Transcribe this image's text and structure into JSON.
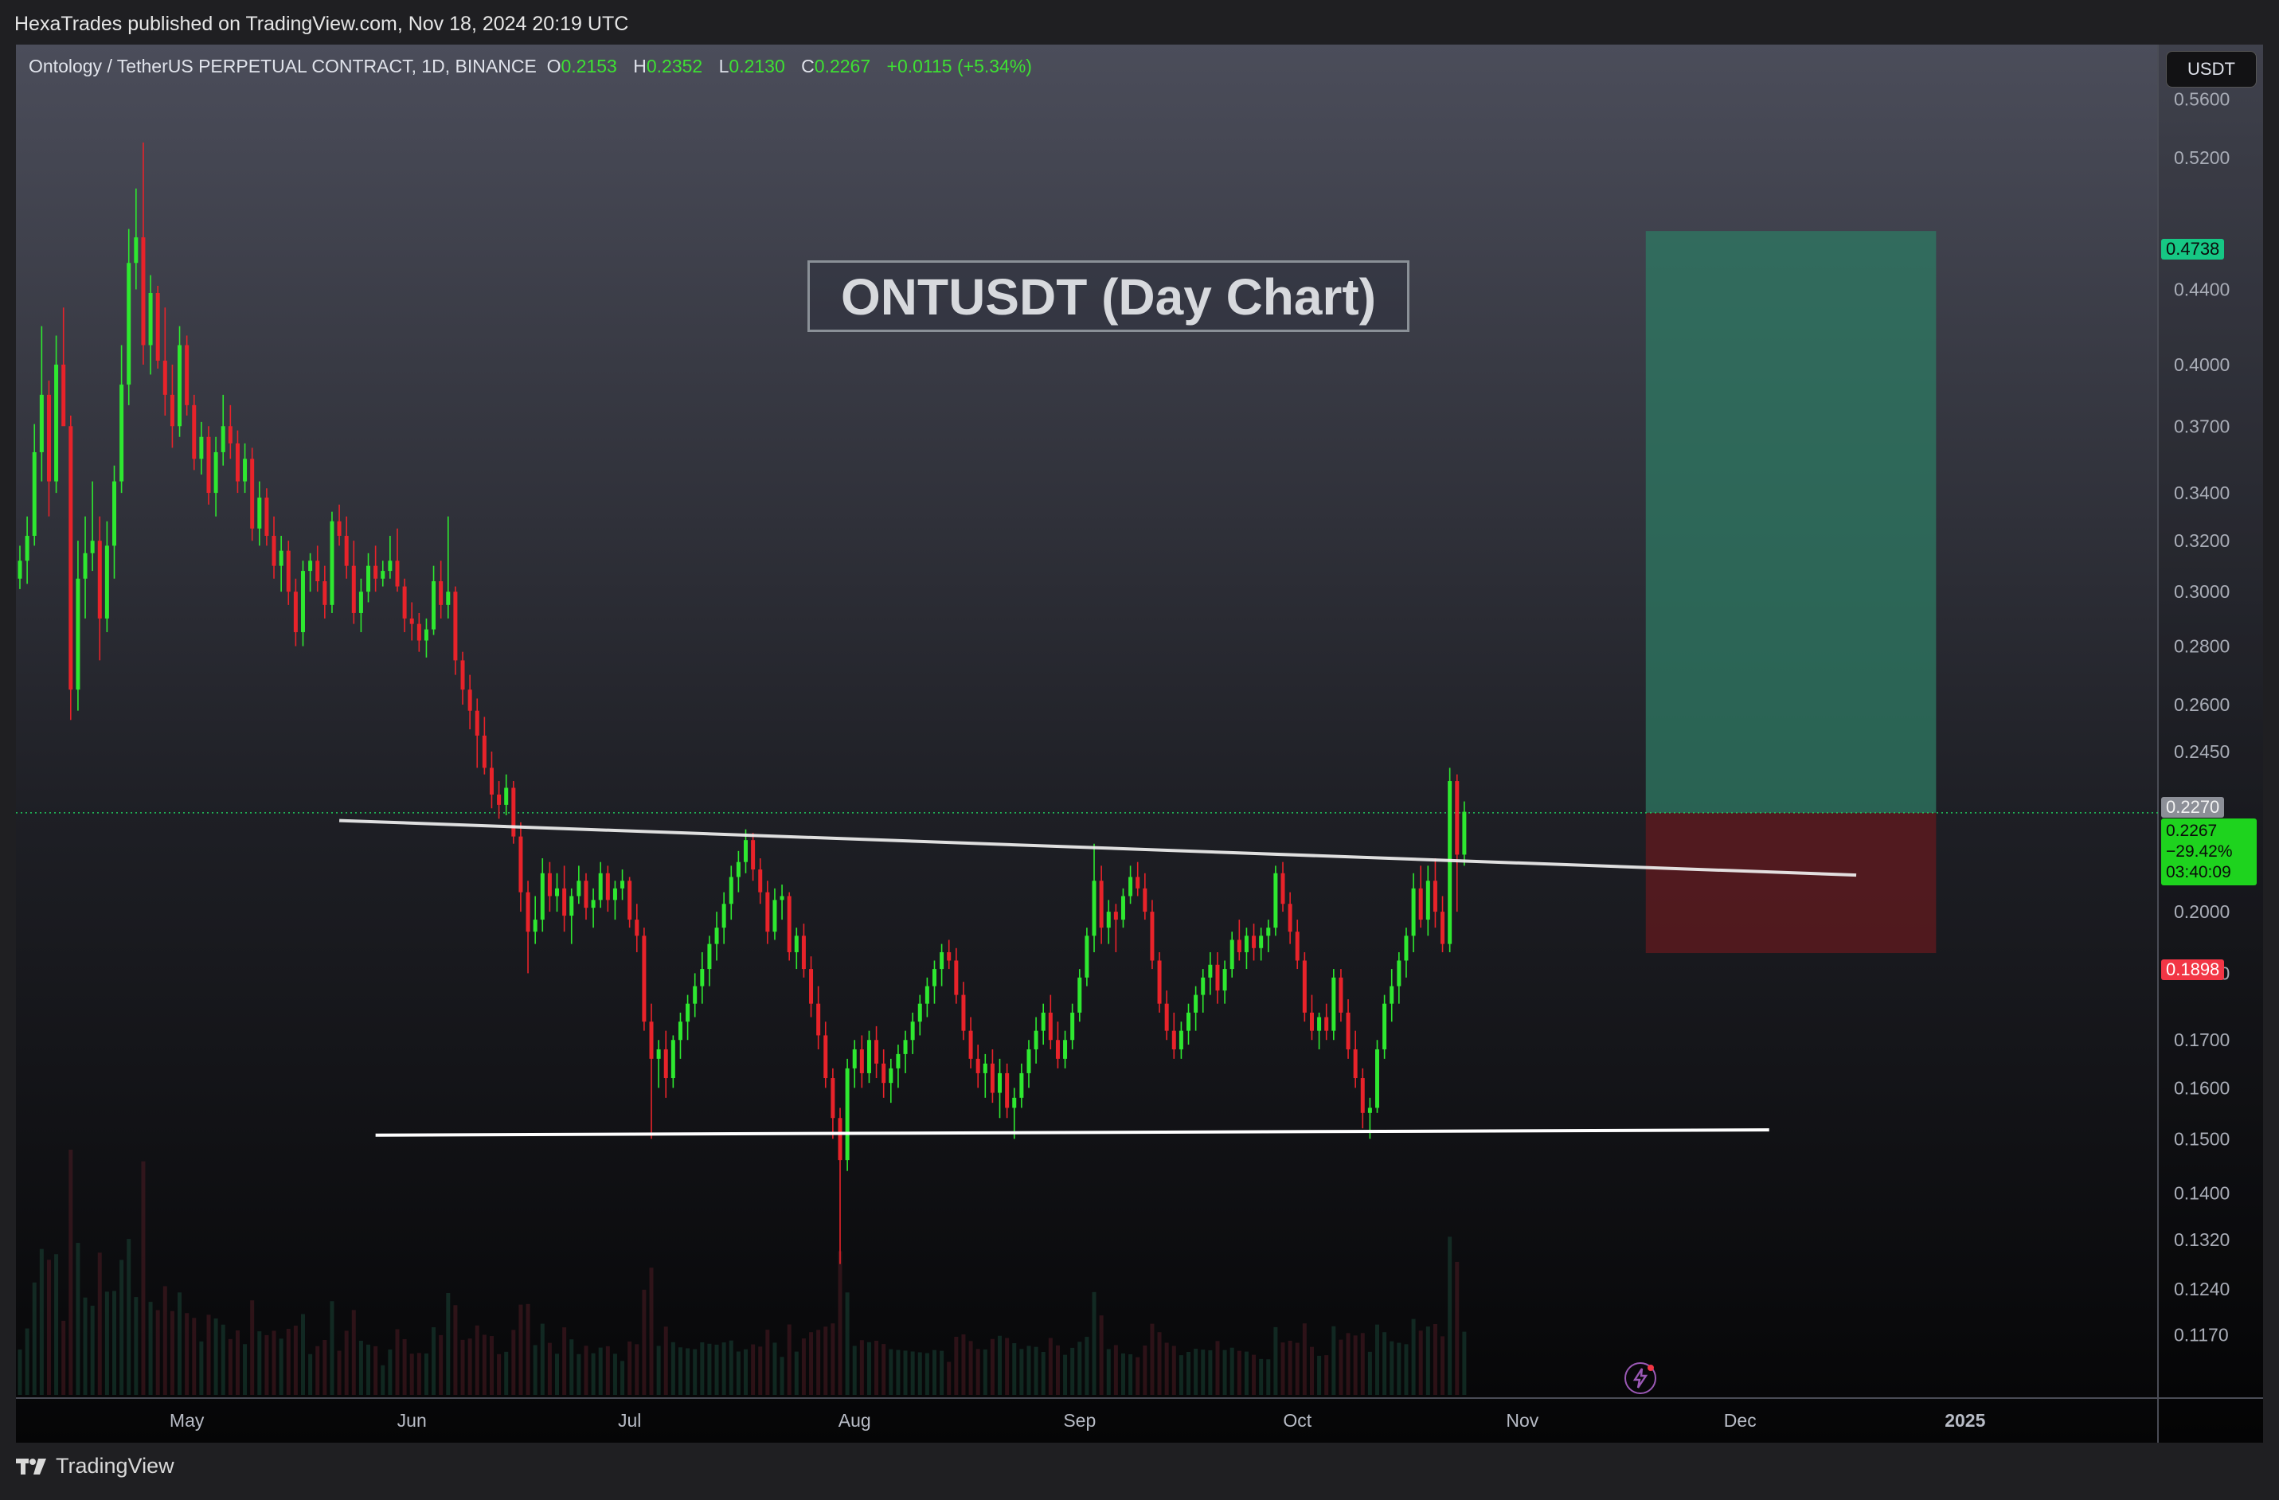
{
  "header": {
    "published": "HexaTrades published on TradingView.com, Nov 18, 2024 20:19 UTC"
  },
  "legend": {
    "symbol": "Ontology / TetherUS PERPETUAL CONTRACT, 1D, BINANCE",
    "o_label": "O",
    "o_value": "0.2153",
    "h_label": "H",
    "h_value": "0.2352",
    "l_label": "L",
    "l_value": "0.2130",
    "c_label": "C",
    "c_value": "0.2267",
    "change": "+0.0115 (+5.34%)"
  },
  "annotation_title": "ONTUSDT (Day Chart)",
  "currency_button": "USDT",
  "price_tags": {
    "target": "0.4738",
    "prev": "0.2270",
    "current": "0.2267",
    "current_pct": "−29.42%",
    "countdown": "03:40:09",
    "stop": "0.1898"
  },
  "footer": {
    "brand": "TradingView"
  },
  "colors": {
    "up": "#2ee830",
    "down": "#e8232a",
    "target_zone": "#2d7a63",
    "stop_zone": "#5a1a1e",
    "price_line": "#22c55e",
    "trendline": "#ffffff"
  },
  "chart_data": {
    "type": "candlestick",
    "title": "ONTUSDT (Day Chart)",
    "scale": "log",
    "y_ticks": [
      0.117,
      0.124,
      0.132,
      0.14,
      0.15,
      0.16,
      0.17,
      0.185,
      0.2,
      0.245,
      0.26,
      0.28,
      0.3,
      0.32,
      0.34,
      0.37,
      0.4,
      0.44,
      0.52,
      0.56
    ],
    "y_tick_labels": [
      "0.1170",
      "0.1240",
      "0.1320",
      "0.1400",
      "0.1500",
      "0.1600",
      "0.1700",
      "0.1850",
      "0.2000",
      "0.2450",
      "0.2600",
      "0.2800",
      "0.3000",
      "0.3200",
      "0.3400",
      "0.3700",
      "0.4000",
      "0.4400",
      "0.5200",
      "0.5600"
    ],
    "ylim": [
      0.108,
      0.6
    ],
    "x_ticks": [
      {
        "label": "May",
        "date": "2024-05-01"
      },
      {
        "label": "Jun",
        "date": "2024-06-01"
      },
      {
        "label": "Jul",
        "date": "2024-07-01"
      },
      {
        "label": "Aug",
        "date": "2024-08-01"
      },
      {
        "label": "Sep",
        "date": "2024-09-01"
      },
      {
        "label": "Oct",
        "date": "2024-10-01"
      },
      {
        "label": "Nov",
        "date": "2024-11-01"
      },
      {
        "label": "Dec",
        "date": "2024-12-01"
      },
      {
        "label": "2025",
        "date": "2025-01-01"
      }
    ],
    "last_close": 0.2267,
    "target_price": 0.4738,
    "entry_price": 0.2267,
    "stop_price": 0.1898,
    "position_start": "2024-11-18",
    "position_end": "2024-12-28",
    "resistance_line": {
      "start_date": "2024-05-22",
      "start_price": 0.2245,
      "end_date": "2024-12-17",
      "end_price": 0.2095
    },
    "support_line": {
      "start_date": "2024-05-27",
      "start_price": 0.1507,
      "end_date": "2024-12-05",
      "end_price": 0.1517
    },
    "candles_ohlc_from_2024-04-08": [
      [
        0.305,
        0.318,
        0.301,
        0.312
      ],
      [
        0.312,
        0.33,
        0.303,
        0.322
      ],
      [
        0.322,
        0.371,
        0.318,
        0.358
      ],
      [
        0.358,
        0.42,
        0.345,
        0.385
      ],
      [
        0.385,
        0.392,
        0.33,
        0.345
      ],
      [
        0.345,
        0.415,
        0.34,
        0.4
      ],
      [
        0.4,
        0.43,
        0.395,
        0.37
      ],
      [
        0.37,
        0.375,
        0.255,
        0.265
      ],
      [
        0.265,
        0.32,
        0.258,
        0.305
      ],
      [
        0.305,
        0.33,
        0.29,
        0.315
      ],
      [
        0.315,
        0.345,
        0.308,
        0.32
      ],
      [
        0.32,
        0.33,
        0.275,
        0.29
      ],
      [
        0.29,
        0.328,
        0.285,
        0.318
      ],
      [
        0.318,
        0.352,
        0.305,
        0.345
      ],
      [
        0.345,
        0.41,
        0.34,
        0.39
      ],
      [
        0.39,
        0.475,
        0.38,
        0.455
      ],
      [
        0.455,
        0.5,
        0.44,
        0.47
      ],
      [
        0.47,
        0.53,
        0.4,
        0.41
      ],
      [
        0.41,
        0.448,
        0.395,
        0.438
      ],
      [
        0.438,
        0.442,
        0.398,
        0.402
      ],
      [
        0.402,
        0.43,
        0.375,
        0.385
      ],
      [
        0.385,
        0.4,
        0.36,
        0.37
      ],
      [
        0.37,
        0.42,
        0.365,
        0.41
      ],
      [
        0.41,
        0.415,
        0.375,
        0.38
      ],
      [
        0.38,
        0.385,
        0.35,
        0.355
      ],
      [
        0.355,
        0.372,
        0.348,
        0.365
      ],
      [
        0.365,
        0.37,
        0.335,
        0.34
      ],
      [
        0.34,
        0.365,
        0.33,
        0.358
      ],
      [
        0.358,
        0.385,
        0.352,
        0.37
      ],
      [
        0.37,
        0.38,
        0.355,
        0.362
      ],
      [
        0.362,
        0.368,
        0.34,
        0.345
      ],
      [
        0.345,
        0.362,
        0.34,
        0.355
      ],
      [
        0.355,
        0.36,
        0.32,
        0.325
      ],
      [
        0.325,
        0.345,
        0.318,
        0.338
      ],
      [
        0.338,
        0.342,
        0.318,
        0.322
      ],
      [
        0.322,
        0.33,
        0.305,
        0.31
      ],
      [
        0.31,
        0.322,
        0.3,
        0.316
      ],
      [
        0.316,
        0.32,
        0.295,
        0.3
      ],
      [
        0.3,
        0.305,
        0.28,
        0.285
      ],
      [
        0.285,
        0.312,
        0.28,
        0.308
      ],
      [
        0.308,
        0.315,
        0.3,
        0.312
      ],
      [
        0.312,
        0.318,
        0.3,
        0.304
      ],
      [
        0.304,
        0.31,
        0.29,
        0.295
      ],
      [
        0.295,
        0.332,
        0.292,
        0.328
      ],
      [
        0.328,
        0.335,
        0.318,
        0.322
      ],
      [
        0.322,
        0.33,
        0.305,
        0.31
      ],
      [
        0.31,
        0.32,
        0.288,
        0.292
      ],
      [
        0.292,
        0.305,
        0.285,
        0.3
      ],
      [
        0.3,
        0.315,
        0.296,
        0.31
      ],
      [
        0.31,
        0.318,
        0.3,
        0.305
      ],
      [
        0.305,
        0.312,
        0.302,
        0.308
      ],
      [
        0.308,
        0.322,
        0.305,
        0.312
      ],
      [
        0.312,
        0.325,
        0.3,
        0.302
      ],
      [
        0.302,
        0.305,
        0.285,
        0.29
      ],
      [
        0.29,
        0.296,
        0.282,
        0.288
      ],
      [
        0.288,
        0.292,
        0.278,
        0.282
      ],
      [
        0.282,
        0.29,
        0.276,
        0.286
      ],
      [
        0.286,
        0.31,
        0.284,
        0.304
      ],
      [
        0.304,
        0.312,
        0.29,
        0.295
      ],
      [
        0.295,
        0.33,
        0.29,
        0.3
      ],
      [
        0.3,
        0.302,
        0.27,
        0.275
      ],
      [
        0.275,
        0.278,
        0.26,
        0.265
      ],
      [
        0.265,
        0.27,
        0.252,
        0.258
      ],
      [
        0.258,
        0.262,
        0.24,
        0.25
      ],
      [
        0.25,
        0.256,
        0.238,
        0.24
      ],
      [
        0.24,
        0.245,
        0.228,
        0.232
      ],
      [
        0.232,
        0.236,
        0.225,
        0.229
      ],
      [
        0.229,
        0.238,
        0.226,
        0.234
      ],
      [
        0.234,
        0.236,
        0.218,
        0.22
      ],
      [
        0.22,
        0.224,
        0.2,
        0.205
      ],
      [
        0.205,
        0.208,
        0.185,
        0.195
      ],
      [
        0.195,
        0.204,
        0.192,
        0.198
      ],
      [
        0.198,
        0.214,
        0.195,
        0.21
      ],
      [
        0.21,
        0.213,
        0.2,
        0.204
      ],
      [
        0.204,
        0.21,
        0.2,
        0.206
      ],
      [
        0.206,
        0.212,
        0.195,
        0.199
      ],
      [
        0.199,
        0.206,
        0.192,
        0.204
      ],
      [
        0.204,
        0.212,
        0.202,
        0.208
      ],
      [
        0.208,
        0.21,
        0.198,
        0.201
      ],
      [
        0.201,
        0.206,
        0.196,
        0.203
      ],
      [
        0.203,
        0.213,
        0.201,
        0.21
      ],
      [
        0.21,
        0.212,
        0.2,
        0.203
      ],
      [
        0.203,
        0.208,
        0.198,
        0.206
      ],
      [
        0.206,
        0.211,
        0.203,
        0.208
      ],
      [
        0.208,
        0.209,
        0.196,
        0.198
      ],
      [
        0.198,
        0.202,
        0.19,
        0.194
      ],
      [
        0.194,
        0.196,
        0.172,
        0.174
      ],
      [
        0.174,
        0.178,
        0.15,
        0.166
      ],
      [
        0.166,
        0.17,
        0.16,
        0.168
      ],
      [
        0.168,
        0.172,
        0.158,
        0.162
      ],
      [
        0.162,
        0.171,
        0.16,
        0.17
      ],
      [
        0.17,
        0.176,
        0.166,
        0.174
      ],
      [
        0.174,
        0.18,
        0.17,
        0.178
      ],
      [
        0.178,
        0.185,
        0.175,
        0.182
      ],
      [
        0.182,
        0.19,
        0.178,
        0.186
      ],
      [
        0.186,
        0.194,
        0.182,
        0.192
      ],
      [
        0.192,
        0.2,
        0.188,
        0.196
      ],
      [
        0.196,
        0.205,
        0.192,
        0.202
      ],
      [
        0.202,
        0.212,
        0.198,
        0.209
      ],
      [
        0.209,
        0.216,
        0.205,
        0.213
      ],
      [
        0.213,
        0.222,
        0.21,
        0.219
      ],
      [
        0.219,
        0.221,
        0.208,
        0.211
      ],
      [
        0.211,
        0.214,
        0.202,
        0.205
      ],
      [
        0.205,
        0.208,
        0.192,
        0.195
      ],
      [
        0.195,
        0.206,
        0.193,
        0.203
      ],
      [
        0.203,
        0.207,
        0.198,
        0.204
      ],
      [
        0.204,
        0.205,
        0.188,
        0.19
      ],
      [
        0.19,
        0.196,
        0.186,
        0.194
      ],
      [
        0.194,
        0.197,
        0.184,
        0.186
      ],
      [
        0.186,
        0.189,
        0.175,
        0.178
      ],
      [
        0.178,
        0.182,
        0.168,
        0.171
      ],
      [
        0.171,
        0.174,
        0.16,
        0.162
      ],
      [
        0.162,
        0.164,
        0.15,
        0.154
      ],
      [
        0.154,
        0.156,
        0.128,
        0.146
      ],
      [
        0.146,
        0.166,
        0.144,
        0.164
      ],
      [
        0.164,
        0.17,
        0.16,
        0.168
      ],
      [
        0.168,
        0.171,
        0.16,
        0.163
      ],
      [
        0.163,
        0.172,
        0.161,
        0.17
      ],
      [
        0.17,
        0.173,
        0.162,
        0.165
      ],
      [
        0.165,
        0.168,
        0.158,
        0.161
      ],
      [
        0.161,
        0.166,
        0.157,
        0.164
      ],
      [
        0.164,
        0.169,
        0.16,
        0.167
      ],
      [
        0.167,
        0.172,
        0.163,
        0.17
      ],
      [
        0.17,
        0.176,
        0.167,
        0.174
      ],
      [
        0.174,
        0.18,
        0.171,
        0.178
      ],
      [
        0.178,
        0.184,
        0.175,
        0.182
      ],
      [
        0.182,
        0.188,
        0.178,
        0.186
      ],
      [
        0.186,
        0.192,
        0.182,
        0.19
      ],
      [
        0.19,
        0.193,
        0.186,
        0.188
      ],
      [
        0.188,
        0.191,
        0.178,
        0.18
      ],
      [
        0.18,
        0.183,
        0.17,
        0.172
      ],
      [
        0.172,
        0.175,
        0.164,
        0.166
      ],
      [
        0.166,
        0.169,
        0.16,
        0.163
      ],
      [
        0.163,
        0.167,
        0.158,
        0.165
      ],
      [
        0.165,
        0.168,
        0.157,
        0.159
      ],
      [
        0.159,
        0.166,
        0.154,
        0.163
      ],
      [
        0.163,
        0.165,
        0.154,
        0.156
      ],
      [
        0.156,
        0.16,
        0.15,
        0.158
      ],
      [
        0.158,
        0.165,
        0.156,
        0.163
      ],
      [
        0.163,
        0.17,
        0.16,
        0.168
      ],
      [
        0.168,
        0.175,
        0.165,
        0.172
      ],
      [
        0.172,
        0.178,
        0.169,
        0.176
      ],
      [
        0.176,
        0.18,
        0.168,
        0.17
      ],
      [
        0.17,
        0.174,
        0.164,
        0.166
      ],
      [
        0.166,
        0.172,
        0.164,
        0.17
      ],
      [
        0.17,
        0.178,
        0.168,
        0.176
      ],
      [
        0.176,
        0.186,
        0.174,
        0.184
      ],
      [
        0.184,
        0.196,
        0.182,
        0.194
      ],
      [
        0.194,
        0.218,
        0.19,
        0.208
      ],
      [
        0.208,
        0.212,
        0.192,
        0.196
      ],
      [
        0.196,
        0.203,
        0.192,
        0.2
      ],
      [
        0.2,
        0.202,
        0.19,
        0.198
      ],
      [
        0.198,
        0.206,
        0.196,
        0.204
      ],
      [
        0.204,
        0.212,
        0.202,
        0.209
      ],
      [
        0.209,
        0.213,
        0.204,
        0.206
      ],
      [
        0.206,
        0.21,
        0.198,
        0.2
      ],
      [
        0.2,
        0.203,
        0.186,
        0.188
      ],
      [
        0.188,
        0.19,
        0.176,
        0.178
      ],
      [
        0.178,
        0.181,
        0.17,
        0.172
      ],
      [
        0.172,
        0.176,
        0.166,
        0.168
      ],
      [
        0.168,
        0.174,
        0.166,
        0.172
      ],
      [
        0.172,
        0.178,
        0.169,
        0.176
      ],
      [
        0.176,
        0.182,
        0.172,
        0.18
      ],
      [
        0.18,
        0.186,
        0.176,
        0.184
      ],
      [
        0.184,
        0.19,
        0.18,
        0.187
      ],
      [
        0.187,
        0.19,
        0.178,
        0.181
      ],
      [
        0.181,
        0.188,
        0.178,
        0.186
      ],
      [
        0.186,
        0.195,
        0.184,
        0.193
      ],
      [
        0.193,
        0.198,
        0.188,
        0.19
      ],
      [
        0.19,
        0.196,
        0.186,
        0.194
      ],
      [
        0.194,
        0.197,
        0.188,
        0.191
      ],
      [
        0.191,
        0.196,
        0.188,
        0.194
      ],
      [
        0.194,
        0.198,
        0.19,
        0.196
      ],
      [
        0.196,
        0.212,
        0.194,
        0.21
      ],
      [
        0.21,
        0.213,
        0.2,
        0.202
      ],
      [
        0.202,
        0.205,
        0.192,
        0.195
      ],
      [
        0.195,
        0.198,
        0.186,
        0.188
      ],
      [
        0.188,
        0.19,
        0.174,
        0.176
      ],
      [
        0.176,
        0.18,
        0.17,
        0.172
      ],
      [
        0.172,
        0.176,
        0.168,
        0.175
      ],
      [
        0.175,
        0.178,
        0.17,
        0.172
      ],
      [
        0.172,
        0.186,
        0.17,
        0.184
      ],
      [
        0.184,
        0.186,
        0.174,
        0.176
      ],
      [
        0.176,
        0.179,
        0.166,
        0.168
      ],
      [
        0.168,
        0.172,
        0.16,
        0.162
      ],
      [
        0.162,
        0.164,
        0.152,
        0.155
      ],
      [
        0.155,
        0.158,
        0.15,
        0.156
      ],
      [
        0.156,
        0.17,
        0.155,
        0.168
      ],
      [
        0.168,
        0.18,
        0.166,
        0.178
      ],
      [
        0.178,
        0.186,
        0.174,
        0.182
      ],
      [
        0.182,
        0.19,
        0.178,
        0.188
      ],
      [
        0.188,
        0.196,
        0.184,
        0.194
      ],
      [
        0.194,
        0.21,
        0.19,
        0.206
      ],
      [
        0.206,
        0.212,
        0.196,
        0.198
      ],
      [
        0.198,
        0.212,
        0.194,
        0.208
      ],
      [
        0.208,
        0.214,
        0.196,
        0.2
      ],
      [
        0.2,
        0.204,
        0.19,
        0.192
      ],
      [
        0.192,
        0.24,
        0.19,
        0.236
      ],
      [
        0.236,
        0.238,
        0.2,
        0.215
      ],
      [
        0.215,
        0.23,
        0.212,
        0.227
      ]
    ]
  }
}
